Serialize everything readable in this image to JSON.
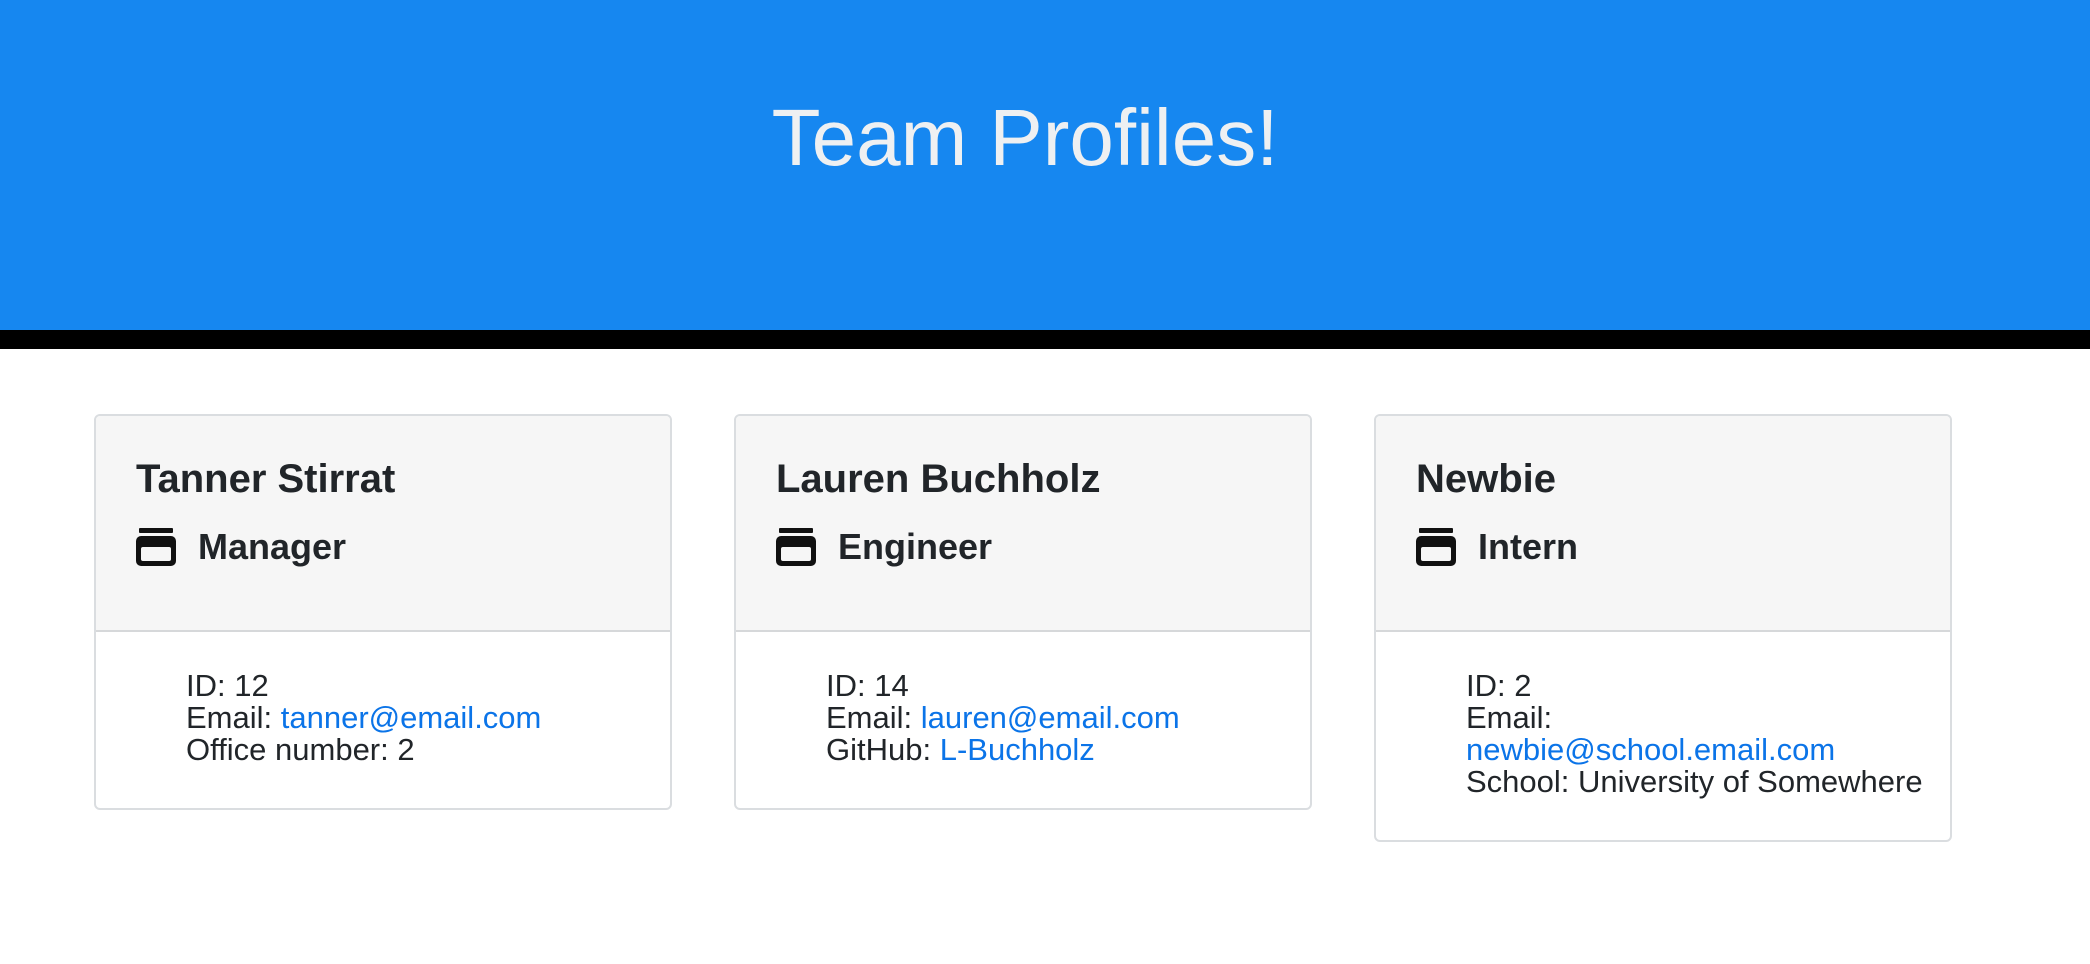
{
  "header": {
    "title": "Team Profiles!",
    "background": "#1687f0",
    "title_color": "#eef0f2"
  },
  "cards": [
    {
      "name": "Tanner Stirrat",
      "role": "Manager",
      "role_icon": "role-card-icon",
      "id_label": "ID: ",
      "id": "12",
      "email_label": "Email: ",
      "email": "tanner@email.com",
      "extra_label": "Office number: ",
      "extra_value": "2"
    },
    {
      "name": "Lauren Buchholz",
      "role": "Engineer",
      "role_icon": "role-card-icon",
      "id_label": "ID: ",
      "id": "14",
      "email_label": "Email: ",
      "email": "lauren@email.com",
      "extra_label": "GitHub: ",
      "extra_value": "L-Buchholz"
    },
    {
      "name": "Newbie",
      "role": "Intern",
      "role_icon": "role-card-icon",
      "id_label": "ID: ",
      "id": "2",
      "email_label": "Email:",
      "email": "newbie@school.email.com",
      "extra_label": "School: ",
      "extra_value": "University of Somewhere"
    }
  ],
  "colors": {
    "link": "#0b74e8",
    "card_header_bg": "#f6f6f6",
    "divider": "#000000"
  }
}
